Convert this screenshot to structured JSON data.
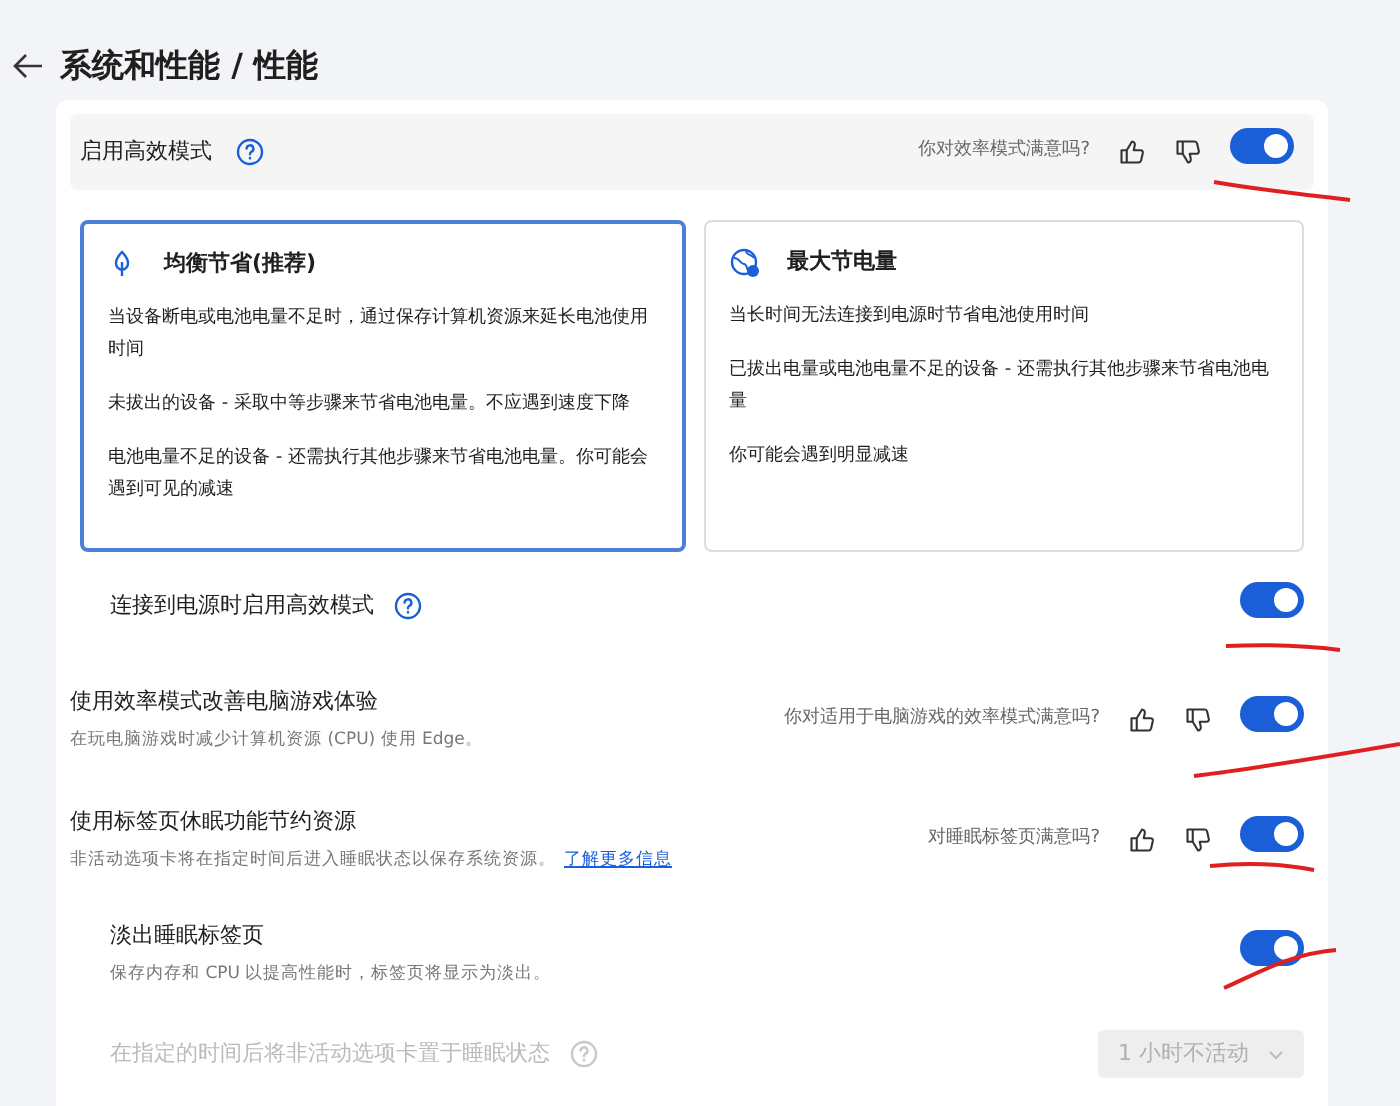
{
  "header": {
    "title": "系统和性能 / 性能"
  },
  "efficiency": {
    "label": "启用高效模式",
    "feedback": "你对效率模式满意吗?",
    "on": true
  },
  "modes": [
    {
      "kind": "leaf",
      "title": "均衡节省(推荐)",
      "selected": true,
      "paragraphs": [
        "当设备断电或电池电量不足时，通过保存计算机资源来延长电池使用时间",
        "未拔出的设备 - 采取中等步骤来节省电池电量。不应遇到速度下降",
        "电池电量不足的设备 - 还需执行其他步骤来节省电池电量。你可能会遇到可见的减速"
      ]
    },
    {
      "kind": "globe",
      "title": "最大节电量",
      "selected": false,
      "paragraphs": [
        "当长时间无法连接到电源时节省电池使用时间",
        "已拔出电量或电池电量不足的设备 - 还需执行其他步骤来节省电池电量",
        "你可能会遇到明显减速"
      ]
    }
  ],
  "settings": [
    {
      "kind": "sub",
      "label": "连接到电源时启用高效模式",
      "help": true,
      "on": true
    },
    {
      "kind": "main",
      "label": "使用效率模式改善电脑游戏体验",
      "description": "在玩电脑游戏时减少计算机资源 (CPU) 使用 Edge。",
      "feedback": "你对适用于电脑游戏的效率模式满意吗?",
      "on": true
    },
    {
      "kind": "main",
      "label": "使用标签页休眠功能节约资源",
      "description": "非活动选项卡将在指定时间后进入睡眠状态以保存系统资源。",
      "link": "了解更多信息",
      "feedback": "对睡眠标签页满意吗?",
      "on": true
    },
    {
      "kind": "sub",
      "label": "淡出睡眠标签页",
      "description": "保存内存和 CPU 以提高性能时，标签页将显示为淡出。",
      "on": true
    },
    {
      "kind": "select",
      "label": "在指定的时间后将非活动选项卡置于睡眠状态",
      "help": true,
      "value": "1 小时不活动",
      "disabled": true
    }
  ]
}
